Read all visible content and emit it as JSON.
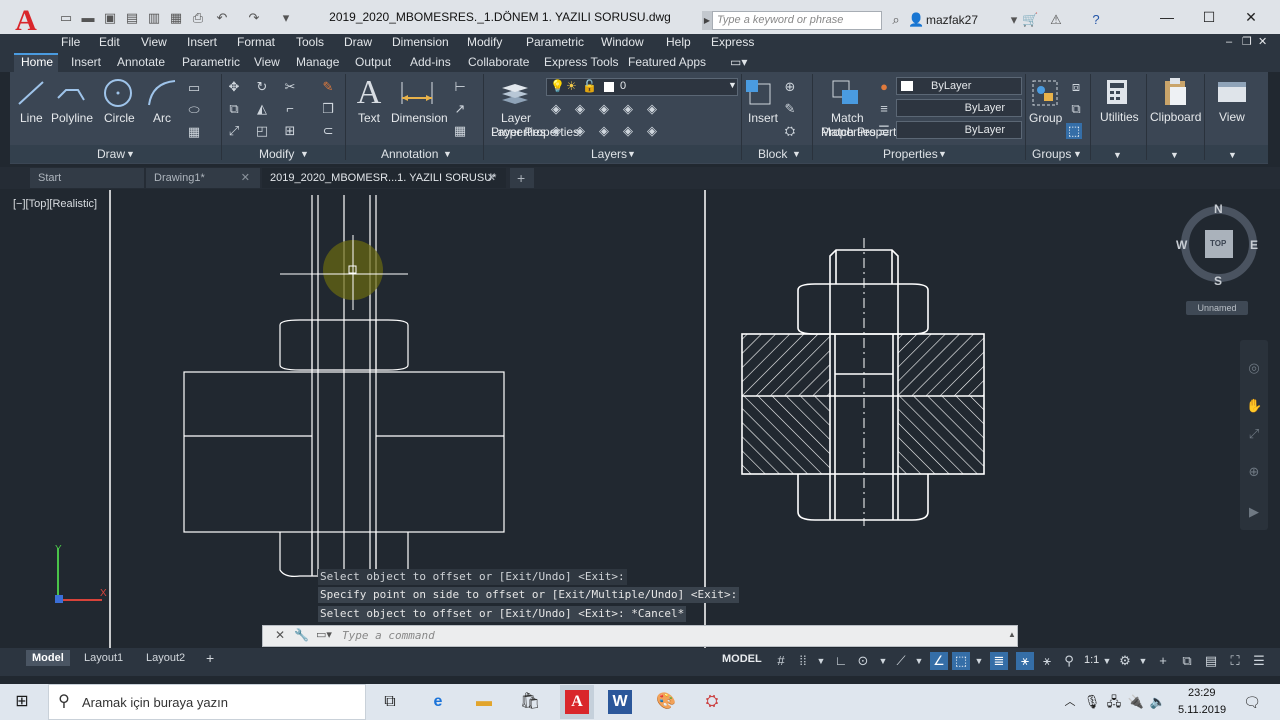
{
  "window": {
    "title": "2019_2020_MBOMESRES._1.DÖNEM 1. YAZILI SORUSU.dwg",
    "search_placeholder": "Type a keyword or phrase",
    "user": "mazfak27"
  },
  "menu": [
    "File",
    "Edit",
    "View",
    "Insert",
    "Format",
    "Tools",
    "Draw",
    "Dimension",
    "Modify",
    "Parametric",
    "Window",
    "Help",
    "Express"
  ],
  "ribbon_tabs": [
    "Home",
    "Insert",
    "Annotate",
    "Parametric",
    "View",
    "Manage",
    "Output",
    "Add-ins",
    "Collaborate",
    "Express Tools",
    "Featured Apps"
  ],
  "ribbon": {
    "draw": {
      "title": "Draw",
      "tools": [
        "Line",
        "Polyline",
        "Circle",
        "Arc"
      ]
    },
    "modify": {
      "title": "Modify"
    },
    "annotation": {
      "title": "Annotation",
      "tools": [
        "Text",
        "Dimension"
      ]
    },
    "layers": {
      "title": "Layers",
      "tool": "Layer Properties",
      "current_layer": "0"
    },
    "block": {
      "title": "Block",
      "tool": "Insert"
    },
    "properties": {
      "title": "Properties",
      "tool": "Match Properties",
      "color": "ByLayer",
      "linetype": "ByLayer",
      "lineweight": "ByLayer"
    },
    "groups": {
      "title": "Groups",
      "tool": "Group"
    },
    "utilities": "Utilities",
    "clipboard": "Clipboard",
    "view": "View"
  },
  "file_tabs": [
    "Start",
    "Drawing1*",
    "2019_2020_MBOMESR...1. YAZILI SORUSU*"
  ],
  "viewport": {
    "label": "[−][Top][Realistic]",
    "cube": {
      "n": "N",
      "s": "S",
      "e": "E",
      "w": "W",
      "top": "TOP"
    },
    "named_view": "Unnamed"
  },
  "command": {
    "history": [
      "Select object to offset or [Exit/Undo] <Exit>:",
      "Specify point on side to offset or [Exit/Multiple/Undo] <Exit>:",
      "Select object to offset or [Exit/Undo] <Exit>: *Cancel*"
    ],
    "placeholder": "Type a command"
  },
  "layout_tabs": [
    "Model",
    "Layout1",
    "Layout2"
  ],
  "status": {
    "model": "MODEL",
    "scale": "1:1"
  },
  "taskbar": {
    "search": "Aramak için buraya yazın",
    "time": "23:29",
    "date": "5.11.2019"
  }
}
